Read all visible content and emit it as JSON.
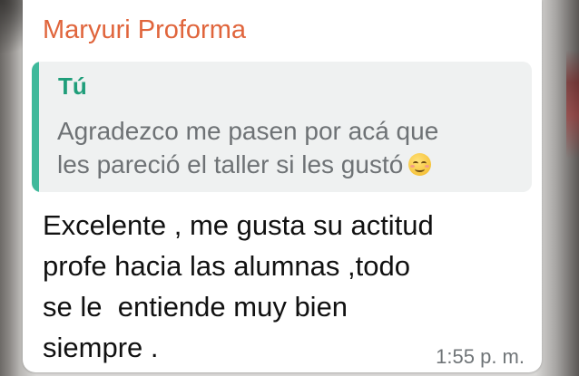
{
  "chat": {
    "sender_name": "Maryuri Proforma",
    "quoted": {
      "author": "Tú",
      "lines": [
        "Agradezco me pasen por acá que",
        "les pareció el taller si les gustó"
      ],
      "emoji": "smiling-face-icon"
    },
    "message": {
      "lines": [
        "Excelente , me gusta su actitud",
        "profe hacia las alumnas ,todo",
        "se le  entiende muy bien",
        "siempre ."
      ]
    },
    "timestamp": "1:55 p. m."
  },
  "colors": {
    "sender": "#e0653c",
    "quote_bar": "#3fb99b",
    "quote_author": "#1f9e7a",
    "quote_bg": "#eff1f1",
    "bubble_bg": "#ffffff"
  }
}
